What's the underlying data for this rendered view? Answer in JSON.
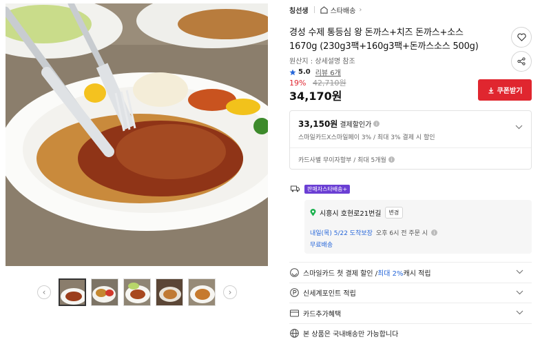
{
  "breadcrumb": {
    "brand": "칭선생",
    "store": "스타배송"
  },
  "product": {
    "title_line1": "경성 수제 통등심 왕 돈까스+치즈 돈까스+소스",
    "title_line2": "1670g (230g3팩+160g3팩+돈까스소스 500g)",
    "origin": "원산지 : 상세설명 참조",
    "rating": "5.0",
    "review_label": "리뷰 6개",
    "discount_pct": "19%",
    "original_price": "42,710원",
    "price": "34,170원",
    "coupon_label": "쿠폰받기"
  },
  "payment_box": {
    "card_price": "33,150원",
    "card_price_label": "결제할인가",
    "card_detail": "스마일카드X스마일페이 3% / 최대 3% 결제 시 할인",
    "installment": "카드사별 무이자할부 / 최대 5개월"
  },
  "shipping": {
    "tag": "판매자스타배송+",
    "address": "시흥시 호현로21번길",
    "change_label": "변경",
    "eta_date": "내일(목) 5/22 도착보장",
    "eta_cond": "오후 6시 전 주문 시",
    "fee": "무료배송"
  },
  "rows": [
    {
      "pre": "스마일카드 첫 결제 할인 / ",
      "hl": "최대 2%",
      "post": " 캐시 적립"
    },
    {
      "pre": "신세계포인트 적립",
      "hl": "",
      "post": ""
    },
    {
      "pre": "카드추가혜택",
      "hl": "",
      "post": ""
    },
    {
      "pre": "본 상품은 국내배송만 가능합니다",
      "hl": "",
      "post": ""
    }
  ],
  "colors": {
    "accent_red": "#e0262f",
    "link_blue": "#2767d9",
    "star_blue": "#2767d9",
    "tag_purple": "#6b3fd4",
    "pin_green": "#1bb14e"
  },
  "icons": [
    "heart-icon",
    "share-icon",
    "store-icon",
    "star-icon",
    "ticket-icon",
    "truck-icon",
    "location-pin-icon",
    "info-icon",
    "chevron-down-icon",
    "chevron-left-icon",
    "chevron-right-icon",
    "smile-card-icon",
    "point-icon",
    "card-icon",
    "globe-icon"
  ]
}
